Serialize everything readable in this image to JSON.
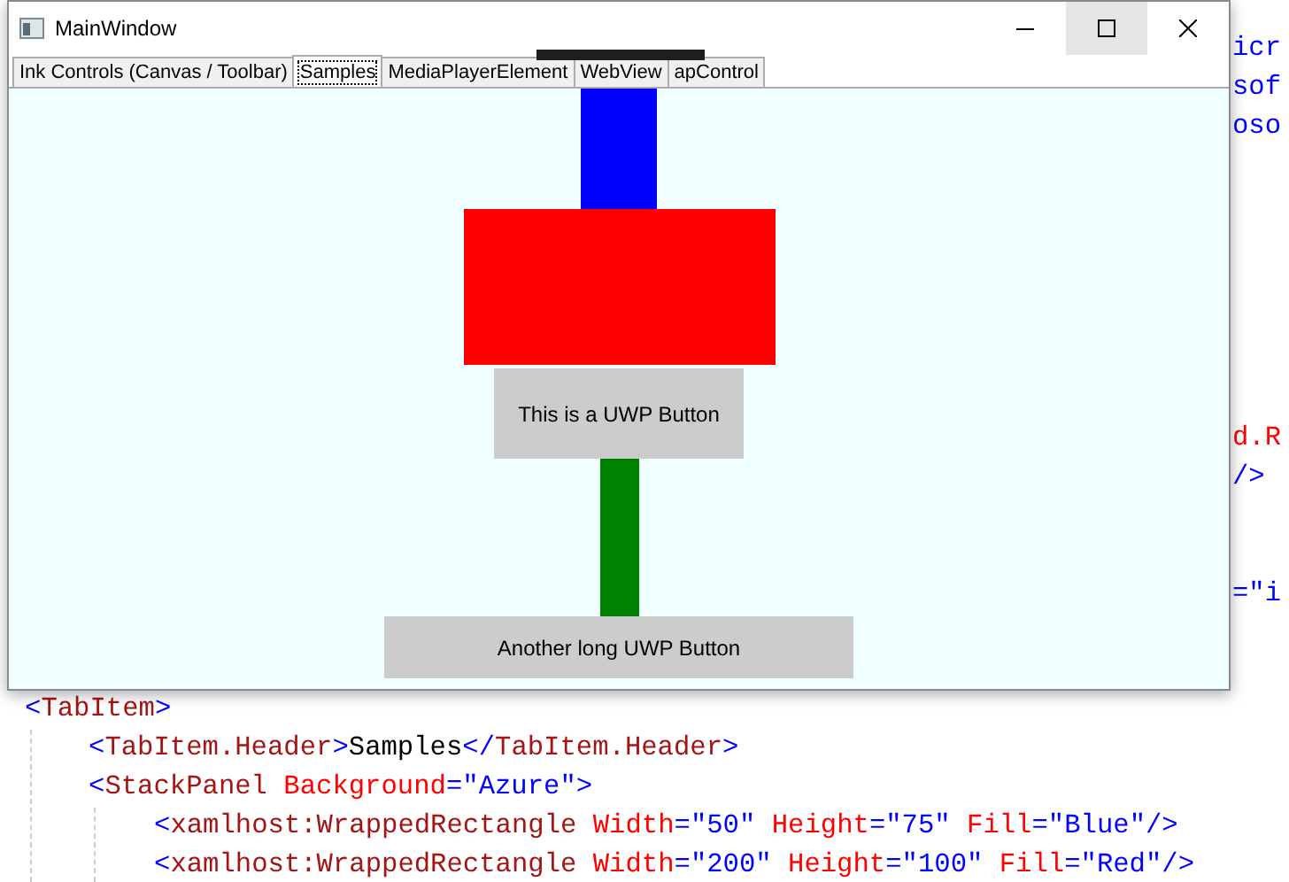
{
  "window": {
    "title": "MainWindow"
  },
  "tabs": [
    {
      "label": "Ink Controls (Canvas / Toolbar)",
      "selected": false
    },
    {
      "label": "Samples",
      "selected": true
    },
    {
      "label": "MediaPlayerElement",
      "selected": false
    },
    {
      "label": "WebView",
      "selected": false
    },
    {
      "label": "apControl",
      "selected": false
    }
  ],
  "panel": [
    {
      "kind": "rect",
      "color": "#0000ff"
    },
    {
      "kind": "rect",
      "color": "#ff0000"
    },
    {
      "kind": "button",
      "label": "This is a UWP Button"
    },
    {
      "kind": "rect",
      "color": "#008000"
    },
    {
      "kind": "button",
      "label": "Another long UWP Button"
    }
  ],
  "editor_fragments": [
    {
      "text": "icr",
      "kind": "value"
    },
    {
      "text": "sof",
      "kind": "value"
    },
    {
      "text": "oso",
      "kind": "value"
    },
    {
      "text": "d.R",
      "kind": "attr"
    },
    {
      "text": "/>",
      "kind": "bracket"
    },
    {
      "text": "=\"i",
      "kind": "value"
    }
  ],
  "code_lines": [
    [
      {
        "text": "<",
        "kind": "bracket"
      },
      {
        "text": "TabItem",
        "kind": "tag"
      },
      {
        "text": ">",
        "kind": "bracket"
      }
    ],
    [
      {
        "text": "<",
        "kind": "bracket"
      },
      {
        "text": "TabItem.Header",
        "kind": "tag"
      },
      {
        "text": ">",
        "kind": "bracket"
      },
      {
        "text": "Samples",
        "kind": "text"
      },
      {
        "text": "</",
        "kind": "bracket"
      },
      {
        "text": "TabItem.Header",
        "kind": "tag"
      },
      {
        "text": ">",
        "kind": "bracket"
      }
    ],
    [
      {
        "text": "<",
        "kind": "bracket"
      },
      {
        "text": "StackPanel",
        "kind": "tag"
      },
      {
        "text": " Background",
        "kind": "attr"
      },
      {
        "text": "=\"Azure\">",
        "kind": "value"
      }
    ],
    [
      {
        "text": "<",
        "kind": "bracket"
      },
      {
        "text": "xamlhost:WrappedRectangle",
        "kind": "tag"
      },
      {
        "text": " Width",
        "kind": "attr"
      },
      {
        "text": "=\"50\"",
        "kind": "value"
      },
      {
        "text": " Height",
        "kind": "attr"
      },
      {
        "text": "=\"75\"",
        "kind": "value"
      },
      {
        "text": " Fill",
        "kind": "attr"
      },
      {
        "text": "=\"Blue\"/>",
        "kind": "value"
      }
    ],
    [
      {
        "text": "<",
        "kind": "bracket"
      },
      {
        "text": "xamlhost:WrappedRectangle",
        "kind": "tag"
      },
      {
        "text": " Width",
        "kind": "attr"
      },
      {
        "text": "=\"200\"",
        "kind": "value"
      },
      {
        "text": " Height",
        "kind": "attr"
      },
      {
        "text": "=\"100\"",
        "kind": "value"
      },
      {
        "text": " Fill",
        "kind": "attr"
      },
      {
        "text": "=\"Red\"/>",
        "kind": "value"
      }
    ]
  ]
}
